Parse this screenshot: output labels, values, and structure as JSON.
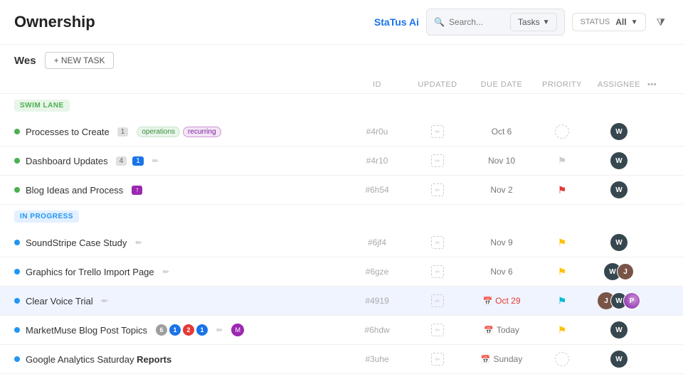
{
  "header": {
    "title": "Ownership",
    "search_placeholder": "Search...",
    "tasks_label": "Tasks",
    "status_label": "STATUS",
    "status_value": "All",
    "ai_brand": "StaTus Ai"
  },
  "subheader": {
    "user": "Wes",
    "new_task_label": "+ NEW TASK"
  },
  "table": {
    "columns": [
      "",
      "ID",
      "UPDATED",
      "DUE DATE",
      "PRIORITY",
      "ASSIGNEE",
      ""
    ],
    "swim_lanes": [
      {
        "label": "SWIM LANE",
        "tasks": [
          {
            "name": "Processes to Create",
            "count": "1",
            "tags": [
              "operations",
              "recurring"
            ],
            "id": "#4r0u",
            "updated": "",
            "due_date": "Oct 6",
            "priority": "circle",
            "assignee": "dark"
          },
          {
            "name": "Dashboard Updates",
            "count": "4",
            "badge": "1",
            "id": "#4r10",
            "tags": [],
            "updated": "",
            "due_date": "Nov 10",
            "priority": "flag-gray",
            "assignee": "dark"
          },
          {
            "name": "Blog Ideas and Process",
            "count_icon": true,
            "id": "#6h54",
            "tags": [],
            "updated": "",
            "due_date": "Nov 2",
            "priority": "flag-red",
            "assignee": "dark"
          }
        ]
      },
      {
        "label": "IN PROGRESS",
        "tasks": [
          {
            "name": "SoundStripe Case Study",
            "edit": true,
            "id": "#6jf4",
            "tags": [],
            "updated": "",
            "due_date": "Nov 9",
            "priority": "flag-yellow",
            "assignee": "dark"
          },
          {
            "name": "Graphics for Trello Import Page",
            "edit": true,
            "id": "#6gze",
            "tags": [],
            "updated": "",
            "due_date": "Nov 6",
            "priority": "flag-yellow",
            "assignee": "multi"
          },
          {
            "name": "Clear Voice Trial",
            "edit": true,
            "id": "#4919",
            "tags": [],
            "updated": "",
            "due_date": "Oct 29",
            "due_overdue": true,
            "priority": "flag-cyan",
            "assignee": "multi2"
          },
          {
            "name": "MarketMuse Blog Post Topics",
            "edit": true,
            "badges": [
              "6",
              "1",
              "2",
              "1"
            ],
            "id": "#6hdw",
            "tags": [],
            "updated": "",
            "due_date": "Today",
            "priority": "flag-yellow",
            "assignee": "dark",
            "has_avatar_badge": true
          },
          {
            "name": "Google Analytics Saturday Reports",
            "id": "#3uhe",
            "tags": [],
            "updated": "",
            "due_date": "Sunday",
            "priority": "circle",
            "assignee": "dark"
          }
        ]
      }
    ]
  }
}
